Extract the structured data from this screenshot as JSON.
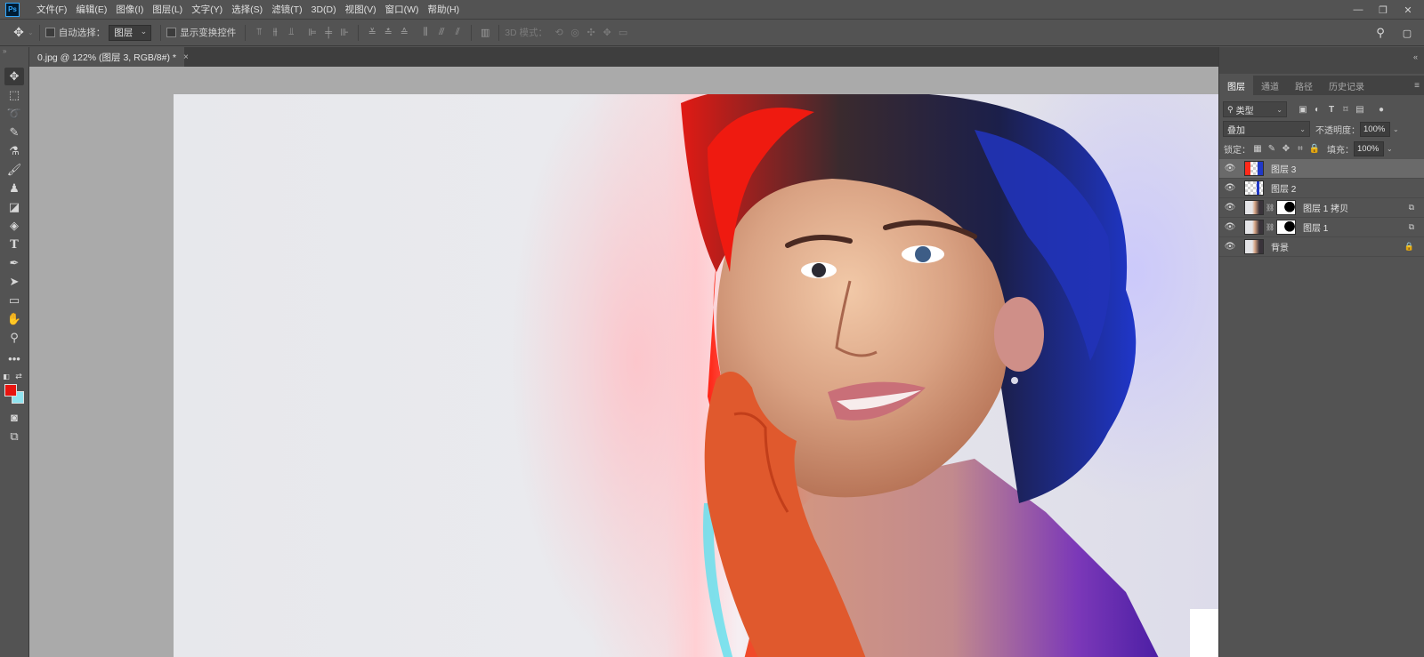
{
  "app": {
    "logo": "Ps"
  },
  "menu": [
    "文件(F)",
    "编辑(E)",
    "图像(I)",
    "图层(L)",
    "文字(Y)",
    "选择(S)",
    "滤镜(T)",
    "3D(D)",
    "视图(V)",
    "窗口(W)",
    "帮助(H)"
  ],
  "window_controls": {
    "minimize": "—",
    "restore": "❐",
    "close": "✕"
  },
  "options": {
    "auto_select_label": "自动选择：",
    "auto_select_value": "图层",
    "show_transform_label": "显示变换控件",
    "mode_3d_label": "3D 模式："
  },
  "document": {
    "tab_title": "0.jpg @ 122% (图层 3, RGB/8#) *",
    "close_glyph": "×"
  },
  "colors": {
    "foreground": "#e8140f",
    "background": "#8fe3ef"
  },
  "layers_panel": {
    "tabs": [
      "图层",
      "通道",
      "路径",
      "历史记录"
    ],
    "active_tab": "图层",
    "filter_kind": "类型",
    "blend_mode": "叠加",
    "opacity_label": "不透明度：",
    "opacity_value": "100%",
    "lock_label": "锁定：",
    "fill_label": "填充：",
    "fill_value": "100%",
    "layers": [
      {
        "name": "图层 3",
        "selected": true
      },
      {
        "name": "图层 2",
        "selected": false
      },
      {
        "name": "图层 1 拷贝",
        "selected": false
      },
      {
        "name": "图层 1",
        "selected": false
      },
      {
        "name": "背景",
        "selected": false
      }
    ]
  }
}
